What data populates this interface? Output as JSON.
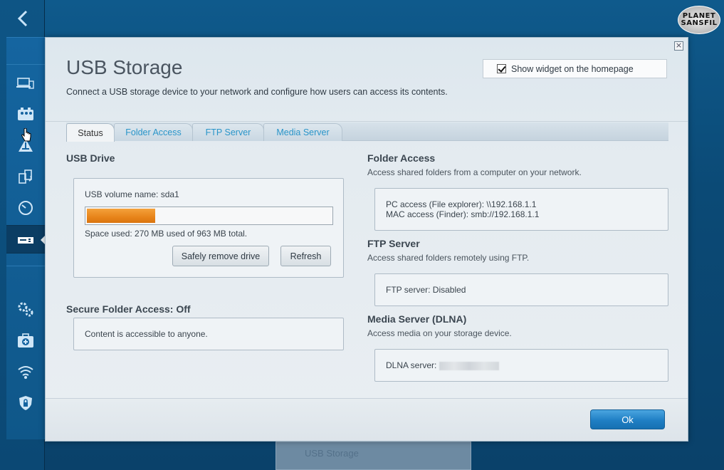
{
  "sidebar": {
    "back_icon": "chevron-left-icon",
    "items": [
      {
        "icon": "devices-icon"
      },
      {
        "icon": "parental-controls-icon"
      },
      {
        "icon": "network-map-icon"
      },
      {
        "icon": "media-prioritization-icon"
      },
      {
        "icon": "speed-test-icon"
      },
      {
        "icon": "usb-icon",
        "active": true
      },
      {
        "icon": "settings-gears-icon"
      },
      {
        "icon": "troubleshooting-icon"
      },
      {
        "icon": "wireless-icon"
      },
      {
        "icon": "security-shield-icon"
      }
    ]
  },
  "logo": {
    "line1": "PLANET",
    "line2": "SANSFIL"
  },
  "background_widget": {
    "label": "USB Storage"
  },
  "modal": {
    "title": "USB Storage",
    "subtitle": "Connect a USB storage device to your network and configure how users can access its contents.",
    "widget_toggle": {
      "label": "Show widget on the homepage",
      "checked": true
    },
    "close_symbol": "×",
    "tabs": [
      {
        "label": "Status",
        "active": true
      },
      {
        "label": "Folder Access",
        "active": false
      },
      {
        "label": "FTP Server",
        "active": false
      },
      {
        "label": "Media Server",
        "active": false
      }
    ],
    "usb_drive": {
      "heading": "USB Drive",
      "volume_name": "USB volume name: sda1",
      "used_mb": 270,
      "total_mb": 963,
      "usage_fraction": 0.28,
      "space_used_text": "Space used: 270 MB used of 963 MB total.",
      "safely_remove_label": "Safely remove drive",
      "refresh_label": "Refresh"
    },
    "secure_folder": {
      "heading": "Secure Folder Access: Off",
      "text": "Content is accessible to anyone."
    },
    "folder_access": {
      "heading": "Folder Access",
      "desc": "Access shared folders from a computer on your network.",
      "pc": "PC access (File explorer): \\\\192.168.1.1",
      "mac": "MAC access (Finder): smb://192.168.1.1"
    },
    "ftp": {
      "heading": "FTP Server",
      "desc": "Access shared folders remotely using FTP.",
      "status": "FTP server: Disabled"
    },
    "media": {
      "heading": "Media Server (DLNA)",
      "desc": "Access media on your storage device.",
      "status_label": "DLNA server:"
    },
    "ok_label": "Ok",
    "colors": {
      "accent": "#1f7fc4",
      "progress": "#e8841a",
      "tab_link": "#2a95c9"
    }
  }
}
